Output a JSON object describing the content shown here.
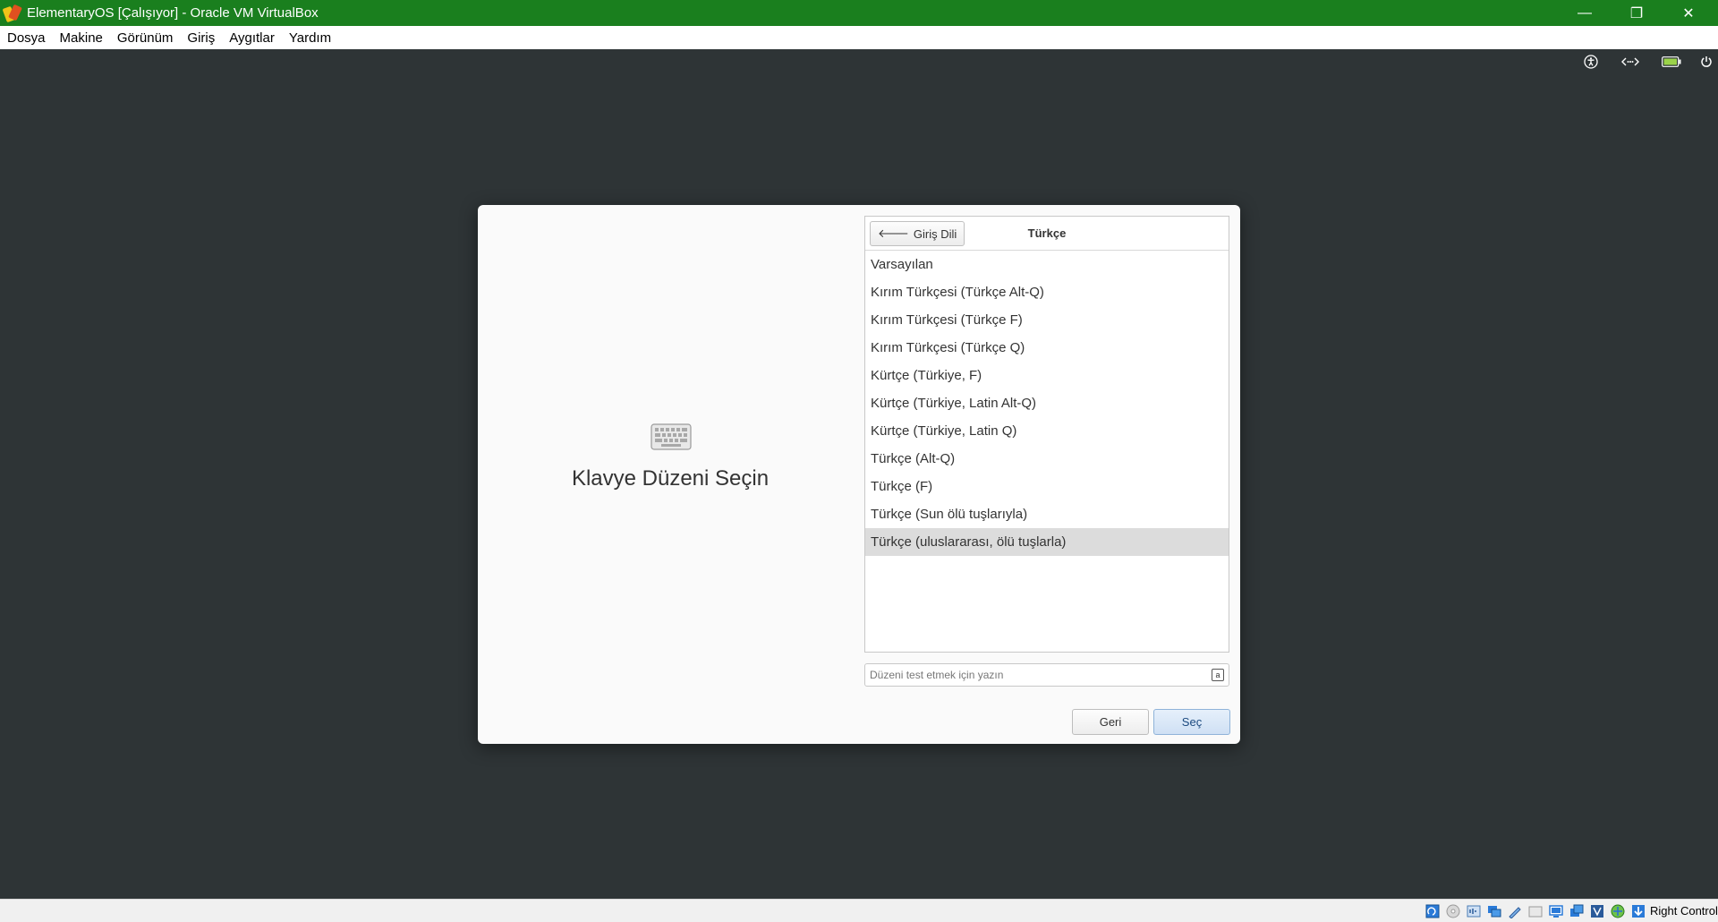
{
  "window": {
    "title": "ElementaryOS [Çalışıyor] - Oracle VM VirtualBox",
    "controls": {
      "minimize": "—",
      "restore": "❐",
      "close": "✕"
    }
  },
  "menubar": {
    "items": [
      "Dosya",
      "Makine",
      "Görünüm",
      "Giriş",
      "Aygıtlar",
      "Yardım"
    ]
  },
  "indicators": [
    "accessibility-icon",
    "network-icon",
    "battery-icon",
    "power-icon"
  ],
  "installer": {
    "left_title": "Klavye Düzeni Seçin",
    "back_button": "Giriş Dili",
    "list_title": "Türkçe",
    "layouts": [
      "Varsayılan",
      "Kırım Türkçesi (Türkçe Alt-Q)",
      "Kırım Türkçesi (Türkçe F)",
      "Kırım Türkçesi (Türkçe Q)",
      "Kürtçe (Türkiye, F)",
      "Kürtçe (Türkiye, Latin Alt-Q)",
      "Kürtçe (Türkiye, Latin Q)",
      "Türkçe (Alt-Q)",
      "Türkçe (F)",
      "Türkçe (Sun ölü tuşlarıyla)",
      "Türkçe (uluslararası, ölü tuşlarla)"
    ],
    "selected_index": 10,
    "test_placeholder": "Düzeni test etmek için yazın",
    "entry_icon_glyph": "a",
    "buttons": {
      "back": "Geri",
      "select": "Seç"
    }
  },
  "statusbar": {
    "right_text": "Right Control"
  },
  "colors": {
    "titlebar": "#1a7f1e",
    "desktop": "#2e3436",
    "selected_row": "#dcdcdc",
    "suggested_button": "#cfe0f4"
  }
}
